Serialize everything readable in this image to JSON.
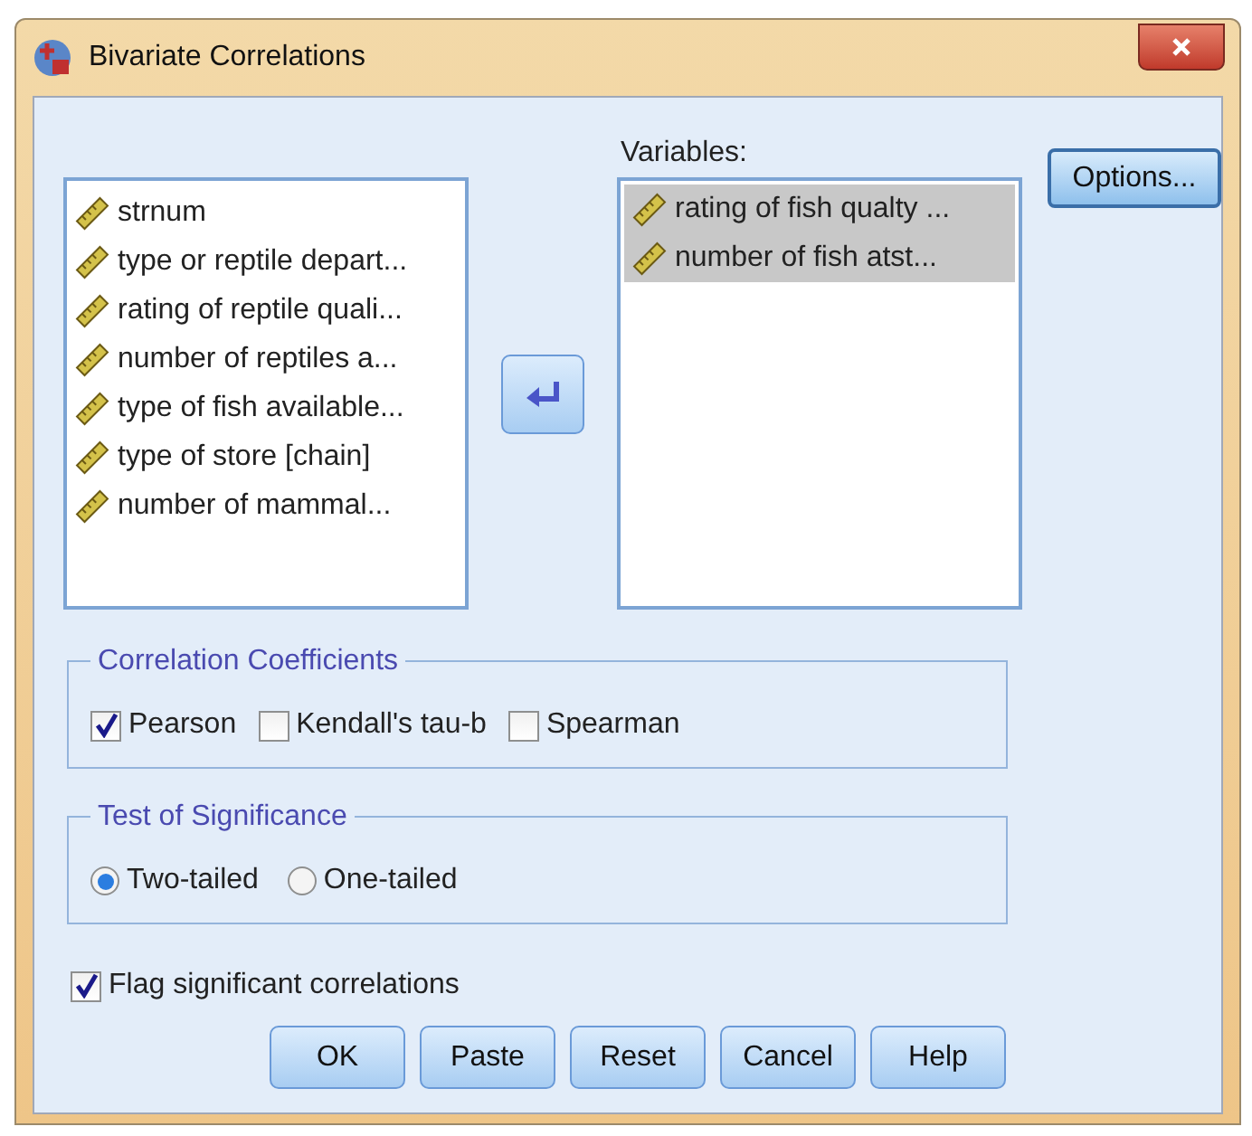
{
  "window": {
    "title": "Bivariate Correlations"
  },
  "source_list": {
    "items": [
      {
        "label": "strnum",
        "selected": false
      },
      {
        "label": "type or reptile depart...",
        "selected": false
      },
      {
        "label": "rating of reptile quali...",
        "selected": false
      },
      {
        "label": "number of reptiles a...",
        "selected": false
      },
      {
        "label": "type of fish available...",
        "selected": false
      },
      {
        "label": "type of store [chain]",
        "selected": false
      },
      {
        "label": "number of mammal...",
        "selected": false
      }
    ]
  },
  "variables": {
    "label": "Variables:",
    "items": [
      {
        "label": "rating of fish qualty ...",
        "selected": true
      },
      {
        "label": "number of fish atst...",
        "selected": true
      }
    ]
  },
  "options_button": "Options...",
  "correlation_coefficients": {
    "title": "Correlation Coefficients",
    "options": [
      {
        "label": "Pearson",
        "checked": true
      },
      {
        "label": "Kendall's tau-b",
        "checked": false
      },
      {
        "label": "Spearman",
        "checked": false
      }
    ]
  },
  "test_of_significance": {
    "title": "Test of Significance",
    "options": [
      {
        "label": "Two-tailed",
        "selected": true
      },
      {
        "label": "One-tailed",
        "selected": false
      }
    ]
  },
  "flag_significant": {
    "label": "Flag significant correlations",
    "checked": true
  },
  "buttons": [
    "OK",
    "Paste",
    "Reset",
    "Cancel",
    "Help"
  ]
}
